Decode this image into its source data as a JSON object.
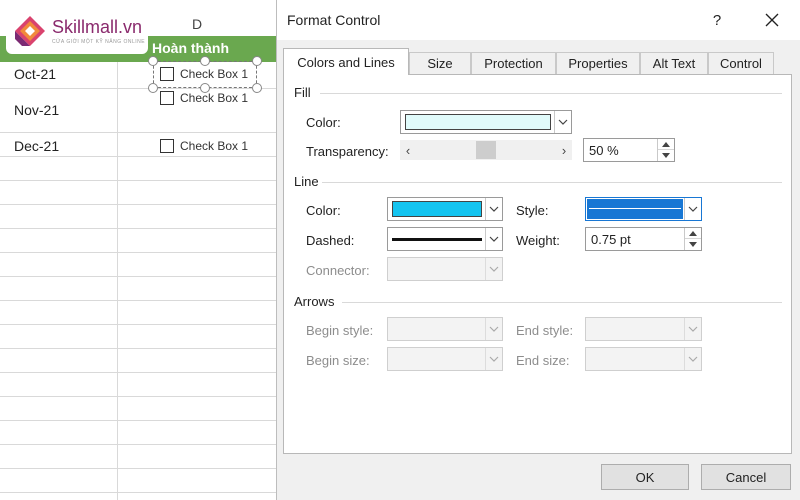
{
  "logo": {
    "name": "Skillmall.vn",
    "tagline": "CỬA GIỚI MỘT KỸ NĂNG ONLINE"
  },
  "sheet": {
    "column_d": "D",
    "header_cell": "Hoàn thành",
    "rows": [
      {
        "month": "Oct-21",
        "checkbox": "Check Box 1"
      },
      {
        "month": "Nov-21",
        "checkbox": "Check Box 1"
      },
      {
        "month": "Dec-21",
        "checkbox": "Check Box 1"
      }
    ]
  },
  "dialog": {
    "title": "Format Control",
    "help": "?",
    "tabs": [
      "Colors and Lines",
      "Size",
      "Protection",
      "Properties",
      "Alt Text",
      "Control"
    ],
    "active_tab": "Colors and Lines",
    "fill": {
      "section": "Fill",
      "color_label": "Color:",
      "color_value": "#e0fbfb",
      "transparency_label": "Transparency:",
      "transparency_fraction": 0.5,
      "transparency_value": "50 %"
    },
    "line": {
      "section": "Line",
      "color_label": "Color:",
      "color_value": "#14c4f0",
      "style_label": "Style:",
      "dashed_label": "Dashed:",
      "weight_label": "Weight:",
      "weight_value": "0.75 pt",
      "connector_label": "Connector:"
    },
    "arrows": {
      "section": "Arrows",
      "begin_style_label": "Begin style:",
      "end_style_label": "End style:",
      "begin_size_label": "Begin size:",
      "end_size_label": "End size:"
    },
    "ok_label": "OK",
    "cancel_label": "Cancel"
  }
}
